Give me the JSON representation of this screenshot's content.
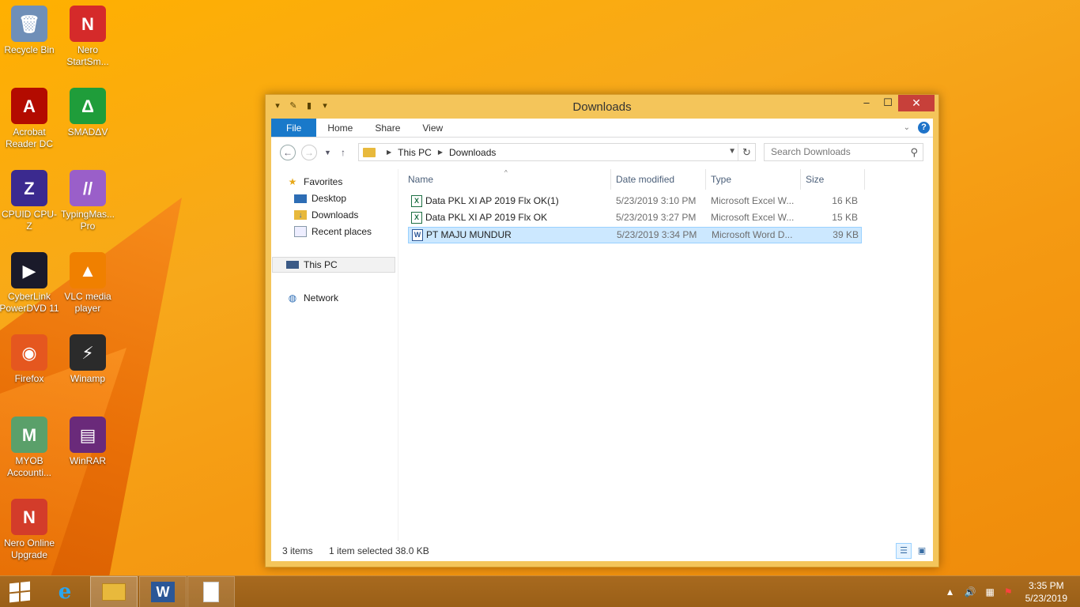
{
  "desktop": {
    "icons": [
      {
        "label": "Recycle Bin",
        "icon": "recycle-bin-icon",
        "color": "#6f8fb8",
        "glyph": "🗑"
      },
      {
        "label": "Nero StartSm...",
        "icon": "nero-icon",
        "color": "#d52a2a",
        "glyph": "N"
      },
      {
        "label": "Acrobat Reader DC",
        "icon": "acrobat-icon",
        "color": "#b30b00",
        "glyph": "A"
      },
      {
        "label": "SMADΔV",
        "icon": "smadav-icon",
        "color": "#1f9d3a",
        "glyph": "Δ"
      },
      {
        "label": "CPUID CPU-Z",
        "icon": "cpuz-icon",
        "color": "#3b2a8f",
        "glyph": "Z"
      },
      {
        "label": "TypingMas... Pro",
        "icon": "typingmaster-icon",
        "color": "#9a5fc9",
        "glyph": "//"
      },
      {
        "label": "CyberLink PowerDVD 11",
        "icon": "powerdvd-icon",
        "color": "#1a1a2a",
        "glyph": "▶"
      },
      {
        "label": "VLC media player",
        "icon": "vlc-icon",
        "color": "#f08000",
        "glyph": "▲"
      },
      {
        "label": "Firefox",
        "icon": "firefox-icon",
        "color": "#e5571f",
        "glyph": "◉"
      },
      {
        "label": "Winamp",
        "icon": "winamp-icon",
        "color": "#2b2b2b",
        "glyph": "⚡"
      },
      {
        "label": "MYOB Accounti...",
        "icon": "myob-icon",
        "color": "#5aa06a",
        "glyph": "M"
      },
      {
        "label": "WinRAR",
        "icon": "winrar-icon",
        "color": "#6a2a7a",
        "glyph": "▤"
      },
      {
        "label": "Nero Online Upgrade",
        "icon": "nero-upgrade-icon",
        "color": "#d33c2a",
        "glyph": "N"
      }
    ]
  },
  "window": {
    "title": "Downloads",
    "controls": {
      "minimize": "–",
      "maximize": "☐",
      "close": "✕"
    },
    "ribbon_tabs": [
      "File",
      "Home",
      "Share",
      "View"
    ],
    "help": "?",
    "address": {
      "segments": [
        "This PC",
        "Downloads"
      ]
    },
    "search": {
      "placeholder": "Search Downloads"
    },
    "navpane": {
      "favorites": "Favorites",
      "desktop": "Desktop",
      "downloads": "Downloads",
      "recent": "Recent places",
      "thispc": "This PC",
      "network": "Network"
    },
    "columns": {
      "name": "Name",
      "date": "Date modified",
      "type": "Type",
      "size": "Size"
    },
    "files": [
      {
        "name": "Data PKL XI AP  2019 Flx  OK(1)",
        "date": "5/23/2019 3:10 PM",
        "type": "Microsoft Excel W...",
        "size": "16 KB",
        "kind": "xls",
        "glyph": "X"
      },
      {
        "name": "Data PKL XI AP  2019 Flx  OK",
        "date": "5/23/2019 3:27 PM",
        "type": "Microsoft Excel W...",
        "size": "15 KB",
        "kind": "xls",
        "glyph": "X"
      },
      {
        "name": "PT MAJU MUNDUR",
        "date": "5/23/2019 3:34 PM",
        "type": "Microsoft Word D...",
        "size": "39 KB",
        "kind": "doc",
        "glyph": "W"
      }
    ],
    "status": {
      "items": "3 items",
      "selected": "1 item selected  38.0 KB"
    }
  },
  "taskbar": {
    "time": "3:35 PM",
    "date": "5/23/2019"
  }
}
